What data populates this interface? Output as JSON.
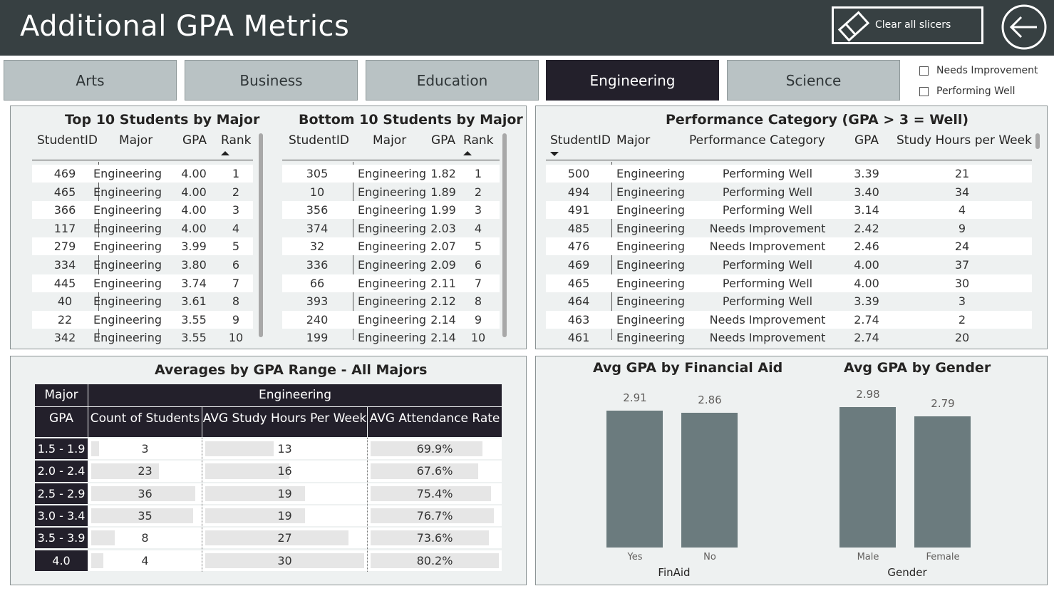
{
  "header": {
    "title": "Additional GPA Metrics",
    "clear_label": "Clear all slicers"
  },
  "tabs": [
    {
      "label": "Arts",
      "active": false
    },
    {
      "label": "Business",
      "active": false
    },
    {
      "label": "Education",
      "active": false
    },
    {
      "label": "Engineering",
      "active": true
    },
    {
      "label": "Science",
      "active": false
    }
  ],
  "filters": [
    "Needs Improvement",
    "Performing Well"
  ],
  "top10": {
    "title": "Top 10 Students by Major",
    "columns": [
      "StudentID",
      "Major",
      "GPA",
      "Rank"
    ],
    "rows": [
      [
        "469",
        "Engineering",
        "4.00",
        "1"
      ],
      [
        "465",
        "Engineering",
        "4.00",
        "2"
      ],
      [
        "366",
        "Engineering",
        "4.00",
        "3"
      ],
      [
        "117",
        "Engineering",
        "4.00",
        "4"
      ],
      [
        "279",
        "Engineering",
        "3.99",
        "5"
      ],
      [
        "334",
        "Engineering",
        "3.80",
        "6"
      ],
      [
        "445",
        "Engineering",
        "3.74",
        "7"
      ],
      [
        "40",
        "Engineering",
        "3.61",
        "8"
      ],
      [
        "22",
        "Engineering",
        "3.55",
        "9"
      ],
      [
        "342",
        "Engineering",
        "3.55",
        "10"
      ]
    ]
  },
  "bottom10": {
    "title": "Bottom 10 Students by Major",
    "columns": [
      "StudentID",
      "Major",
      "GPA",
      "Rank"
    ],
    "rows": [
      [
        "305",
        "Engineering",
        "1.82",
        "1"
      ],
      [
        "10",
        "Engineering",
        "1.89",
        "2"
      ],
      [
        "356",
        "Engineering",
        "1.99",
        "3"
      ],
      [
        "374",
        "Engineering",
        "2.03",
        "4"
      ],
      [
        "32",
        "Engineering",
        "2.07",
        "5"
      ],
      [
        "336",
        "Engineering",
        "2.09",
        "6"
      ],
      [
        "66",
        "Engineering",
        "2.11",
        "7"
      ],
      [
        "393",
        "Engineering",
        "2.12",
        "8"
      ],
      [
        "240",
        "Engineering",
        "2.14",
        "9"
      ],
      [
        "199",
        "Engineering",
        "2.14",
        "10"
      ]
    ]
  },
  "perf": {
    "title": "Performance Category (GPA > 3 = Well)",
    "columns": [
      "StudentID",
      "Major",
      "Performance Category",
      "GPA",
      "Study Hours per Week"
    ],
    "rows": [
      [
        "500",
        "Engineering",
        "Performing Well",
        "3.39",
        "21"
      ],
      [
        "494",
        "Engineering",
        "Performing Well",
        "3.40",
        "34"
      ],
      [
        "491",
        "Engineering",
        "Performing Well",
        "3.14",
        "4"
      ],
      [
        "485",
        "Engineering",
        "Needs Improvement",
        "2.42",
        "9"
      ],
      [
        "476",
        "Engineering",
        "Needs Improvement",
        "2.46",
        "24"
      ],
      [
        "469",
        "Engineering",
        "Performing Well",
        "4.00",
        "37"
      ],
      [
        "465",
        "Engineering",
        "Performing Well",
        "4.00",
        "30"
      ],
      [
        "464",
        "Engineering",
        "Performing Well",
        "3.39",
        "3"
      ],
      [
        "463",
        "Engineering",
        "Needs Improvement",
        "2.74",
        "2"
      ],
      [
        "461",
        "Engineering",
        "Needs Improvement",
        "2.74",
        "20"
      ]
    ]
  },
  "averages": {
    "title": "Averages by GPA Range - All Majors",
    "major_label": "Major",
    "major_value": "Engineering",
    "gpa_label": "GPA",
    "columns": [
      "Count of Students",
      "AVG Study Hours Per Week",
      "AVG Attendance Rate"
    ],
    "rows": [
      {
        "range": "1.5 - 1.9",
        "count": "3",
        "count_frac": 0.07,
        "hours": "13",
        "hours_frac": 0.43,
        "att": "69.9%",
        "att_frac": 0.87
      },
      {
        "range": "2.0 - 2.4",
        "count": "23",
        "count_frac": 0.63,
        "hours": "16",
        "hours_frac": 0.53,
        "att": "67.6%",
        "att_frac": 0.84
      },
      {
        "range": "2.5 - 2.9",
        "count": "36",
        "count_frac": 0.97,
        "hours": "19",
        "hours_frac": 0.63,
        "att": "75.4%",
        "att_frac": 0.94
      },
      {
        "range": "3.0 - 3.4",
        "count": "35",
        "count_frac": 0.95,
        "hours": "19",
        "hours_frac": 0.63,
        "att": "76.7%",
        "att_frac": 0.96
      },
      {
        "range": "3.5 - 3.9",
        "count": "8",
        "count_frac": 0.22,
        "hours": "27",
        "hours_frac": 0.9,
        "att": "73.6%",
        "att_frac": 0.92
      },
      {
        "range": "4.0",
        "count": "4",
        "count_frac": 0.11,
        "hours": "30",
        "hours_frac": 1.0,
        "att": "80.2%",
        "att_frac": 1.0
      }
    ]
  },
  "chart_data": [
    {
      "type": "bar",
      "title": "Avg GPA by Financial Aid",
      "xlabel": "FinAid",
      "ylabel": "",
      "categories": [
        "Yes",
        "No"
      ],
      "values": [
        2.91,
        2.86
      ],
      "labels": [
        "2.91",
        "2.86"
      ],
      "ylim": [
        0,
        2.98
      ],
      "color": "#6b7b7e"
    },
    {
      "type": "bar",
      "title": "Avg GPA by Gender",
      "xlabel": "Gender",
      "ylabel": "",
      "categories": [
        "Male",
        "Female"
      ],
      "values": [
        2.98,
        2.79
      ],
      "labels": [
        "2.98",
        "2.79"
      ],
      "ylim": [
        0,
        2.98
      ],
      "color": "#6b7b7e"
    }
  ]
}
